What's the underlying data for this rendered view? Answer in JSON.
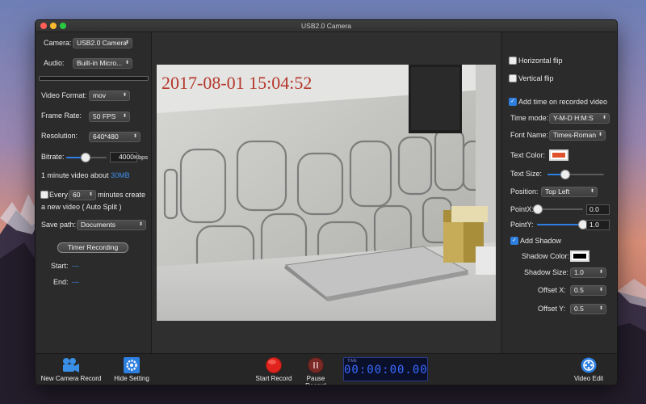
{
  "window": {
    "title": "USB2.0 Camera"
  },
  "left": {
    "camera_label": "Camera:",
    "camera_value": "USB2.0 Camera",
    "audio_label": "Audio:",
    "audio_value": "Built-in Micro...",
    "video_format_label": "Video Format:",
    "video_format_value": "mov",
    "frame_rate_label": "Frame Rate:",
    "frame_rate_value": "50 FPS",
    "resolution_label": "Resolution:",
    "resolution_value": "640*480",
    "bitrate_label": "Bitrate:",
    "bitrate_value": "4000",
    "bitrate_unit": "Kbps",
    "bitrate_fraction": 0.45,
    "minute_text": "1 minute video about",
    "minute_size": "30MB",
    "every_label": "Every",
    "every_value": "60",
    "minutes_text": "minutes create",
    "new_video_text": "a new video ( Auto Split )",
    "save_path_label": "Save path:",
    "save_path_value": "Documents",
    "timer_recording_label": "Timer Recording",
    "start_label": "Start:",
    "start_value": "---",
    "end_label": "End:",
    "end_value": "---"
  },
  "video": {
    "overlay_time": "2017-08-01 15:04:52"
  },
  "right": {
    "horizontal_flip": "Horizontal flip",
    "vertical_flip": "Vertical flip",
    "add_time": "Add time on recorded video",
    "time_mode_label": "Time mode:",
    "time_mode_value": "Y-M-D H:M:S",
    "font_name_label": "Font Name:",
    "font_name_value": "Times-Roman",
    "text_color_label": "Text Color:",
    "text_color": "#e0522c",
    "text_size_label": "Text Size:",
    "text_size_fraction": 0.3,
    "position_label": "Position:",
    "position_value": "Top Left",
    "pointx_label": "PointX:",
    "pointx_value": "0.0",
    "pointy_label": "PointY:",
    "pointy_value": "1.0",
    "add_shadow": "Add Shadow",
    "shadow_color_label": "Shadow Color:",
    "shadow_color": "#000000",
    "shadow_size_label": "Shadow Size:",
    "shadow_size_value": "1.0",
    "offset_x_label": "Offset X:",
    "offset_x_value": "0.5",
    "offset_y_label": "Offset Y:",
    "offset_y_value": "0.5"
  },
  "bottom": {
    "new_camera_record": "New Camera Record",
    "hide_setting": "Hide Setting",
    "start_record": "Start Record",
    "pause_record": "Pause Record",
    "timer_label": "TIME",
    "timer_value": "00:00:00.00",
    "video_edit": "Video Edit"
  },
  "colors": {
    "accent": "#2d7fe0",
    "record_red": "#e0231c"
  },
  "icons": {
    "new_camera_record": "video-camera-icon",
    "hide_setting": "gear-icon",
    "start_record": "record-icon",
    "pause_record": "pause-icon",
    "video_edit": "film-reel-icon"
  }
}
